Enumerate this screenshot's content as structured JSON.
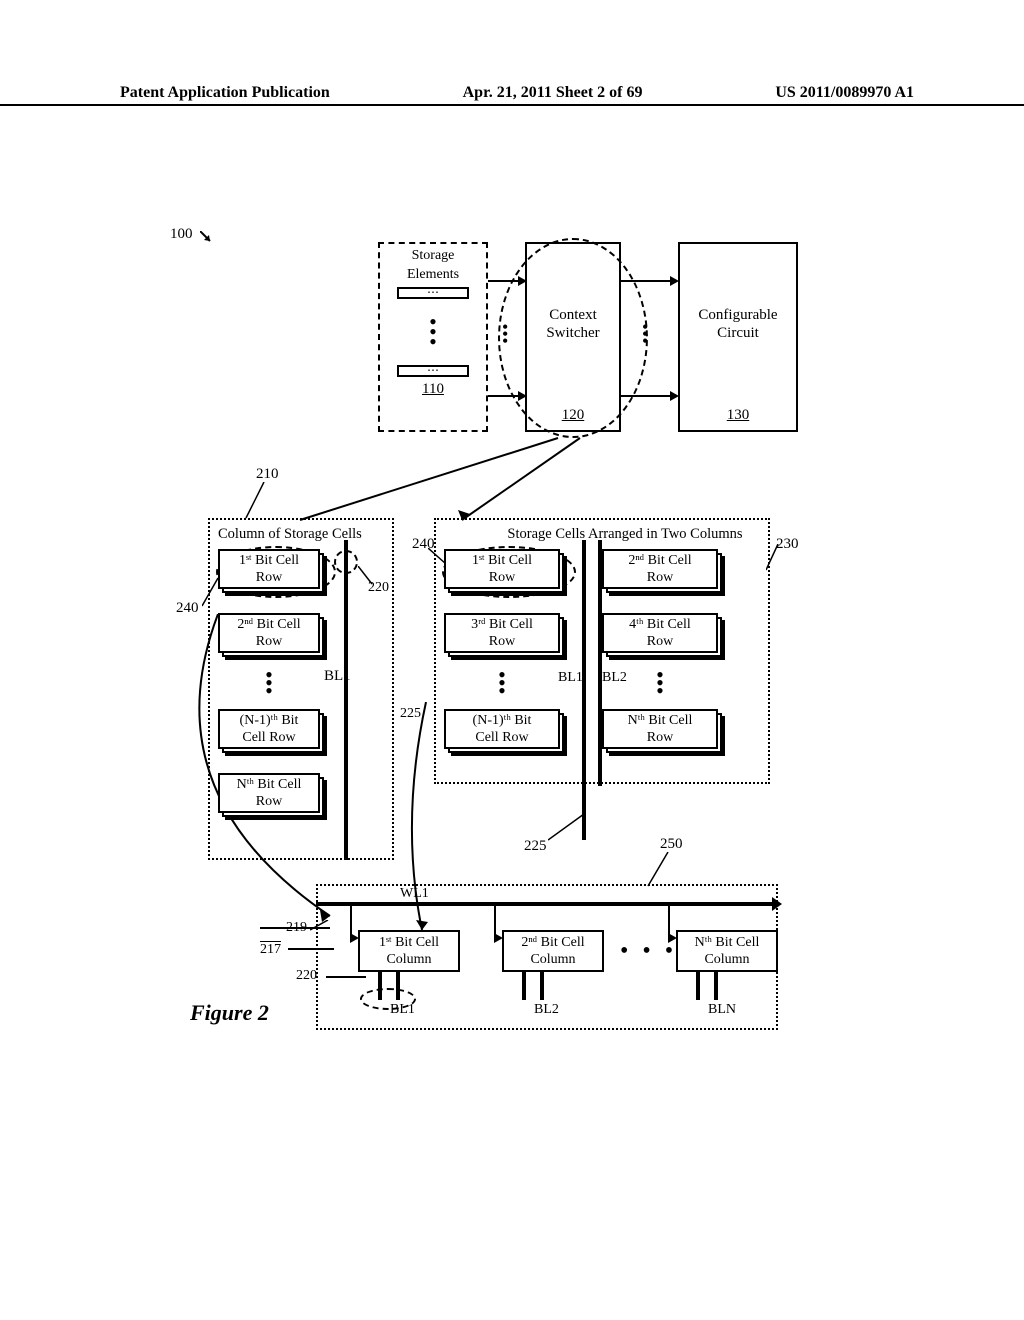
{
  "header": {
    "left": "Patent Application Publication",
    "center": "Apr. 21, 2011  Sheet 2 of 69",
    "right": "US 2011/0089970 A1"
  },
  "top": {
    "ref100": "100",
    "storageElements": {
      "title1": "Storage",
      "title2": "Elements",
      "ref": "110"
    },
    "contextSwitcher": {
      "line1": "Context",
      "line2": "Switcher",
      "ref": "120"
    },
    "configurable": {
      "line1": "Configurable",
      "line2": "Circuit",
      "ref": "130"
    }
  },
  "refs": {
    "r210": "210",
    "r220a": "220",
    "r225a": "225",
    "r240a": "240",
    "r240b": "240",
    "r230": "230",
    "r225b": "225",
    "r250": "250",
    "r219": "219",
    "r217": "217",
    "r220b": "220"
  },
  "panel210": {
    "title": "Column of Storage Cells",
    "cells": {
      "c1": {
        "l1": "1ˢᵗ Bit Cell",
        "l2": "Row"
      },
      "c2": {
        "l1": "2ⁿᵈ Bit Cell",
        "l2": "Row"
      },
      "c3": {
        "l1": "(N-1)ᵗʰ Bit",
        "l2": "Cell Row"
      },
      "c4": {
        "l1": "Nᵗʰ Bit Cell",
        "l2": "Row"
      }
    },
    "bl": "BL1"
  },
  "panel230": {
    "title": "Storage Cells Arranged in Two Columns",
    "cells": {
      "c1": {
        "l1": "1ˢᵗ Bit Cell",
        "l2": "Row"
      },
      "c2": {
        "l1": "2ⁿᵈ Bit Cell",
        "l2": "Row"
      },
      "c3": {
        "l1": "3ʳᵈ Bit Cell",
        "l2": "Row"
      },
      "c4": {
        "l1": "4ᵗʰ Bit Cell",
        "l2": "Row"
      },
      "c5": {
        "l1": "(N-1)ᵗʰ Bit",
        "l2": "Cell Row"
      },
      "c6": {
        "l1": "Nᵗʰ Bit Cell",
        "l2": "Row"
      }
    },
    "bl1": "BL1",
    "bl2": "BL2"
  },
  "panel250": {
    "wl": "WL1",
    "cells": {
      "c1": {
        "l1": "1ˢᵗ Bit Cell",
        "l2": "Column"
      },
      "c2": {
        "l1": "2ⁿᵈ Bit Cell",
        "l2": "Column"
      },
      "c3": {
        "l1": "Nᵗʰ Bit Cell",
        "l2": "Column"
      }
    },
    "bl1": "BL1",
    "bl2": "BL2",
    "bln": "BLN"
  },
  "figure": "Figure 2"
}
